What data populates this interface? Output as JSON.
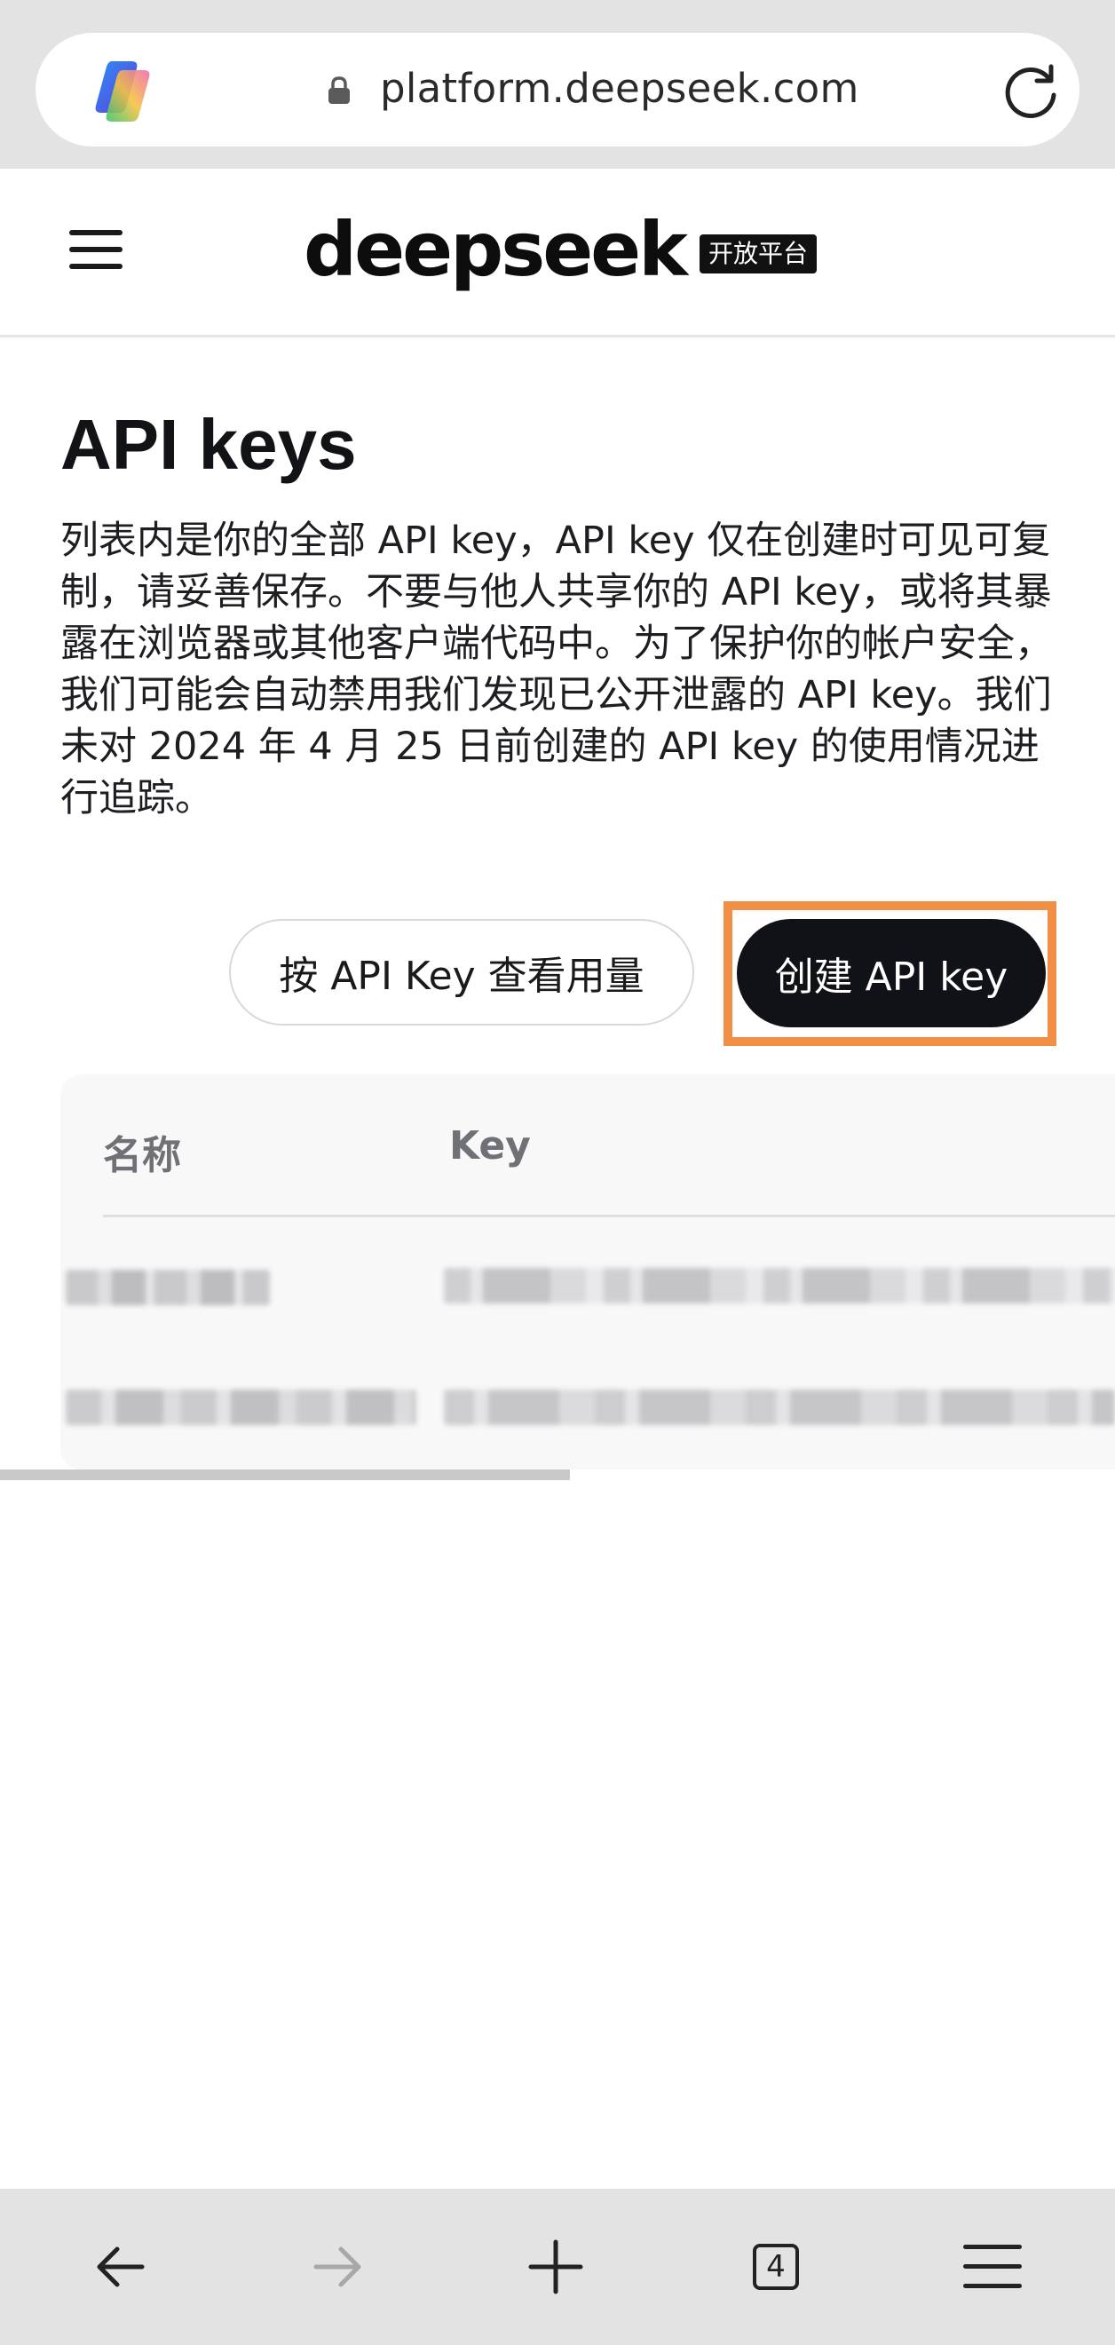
{
  "browser": {
    "url": "platform.deepseek.com",
    "open_tabs": "4"
  },
  "header": {
    "brand_name": "deepseek",
    "brand_badge": "开放平台"
  },
  "main": {
    "title": "API keys",
    "description": "列表内是你的全部 API key，API key 仅在创建时可见可复制，请妥善保存。不要与他人共享你的 API key，或将其暴露在浏览器或其他客户端代码中。为了保护你的帐户安全，我们可能会自动禁用我们发现已公开泄露的 API key。我们未对 2024 年 4 月 25 日前创建的 API key 的使用情况进行追踪。",
    "usage_button": "按 API Key 查看用量",
    "create_button": "创建 API key"
  },
  "table": {
    "columns": [
      "名称",
      "Key"
    ],
    "rows_visible": 2
  },
  "colors": {
    "highlight": "#f18f47",
    "primary_button": "#111217"
  },
  "icons": [
    "copilot-logo",
    "lock-icon",
    "reload-icon",
    "hamburger-menu-icon",
    "back-arrow-icon",
    "forward-arrow-icon",
    "plus-icon",
    "tabs-icon",
    "browser-menu-icon"
  ]
}
